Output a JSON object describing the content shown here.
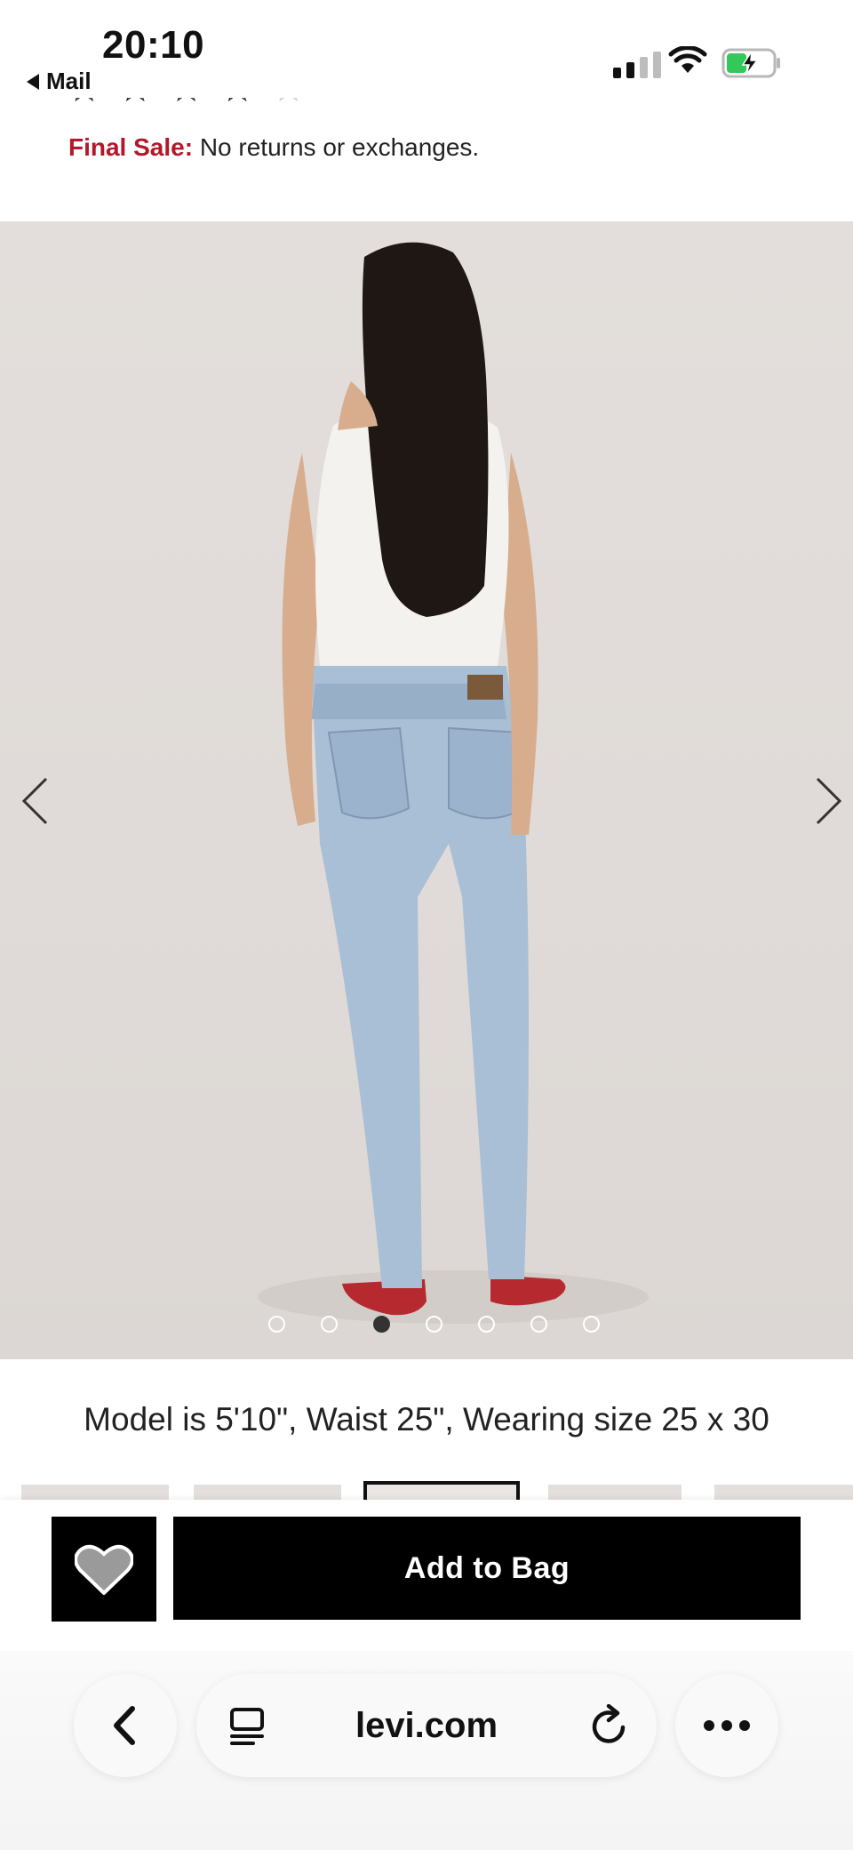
{
  "status_bar": {
    "time": "20:10",
    "back_label": "Mail",
    "icons": [
      "signal-icon",
      "wifi-icon",
      "battery-charging-icon"
    ]
  },
  "rating": {
    "stars_filled": 4,
    "stars_total": 5
  },
  "final_sale": {
    "label": "Final Sale:",
    "text": "No returns or exchanges.",
    "label_color": "#b3182a"
  },
  "gallery": {
    "image_description_icon": "product-photo-back-view",
    "dots_total": 7,
    "active_dot": 3,
    "prev_icon": "chevron-left-icon",
    "next_icon": "chevron-right-icon"
  },
  "model_info": "Model is 5'10\", Waist 25\", Wearing size 25 x 30",
  "actions": {
    "wishlist_icon": "heart-icon",
    "add_to_bag": "Add to Bag"
  },
  "browser": {
    "url": "levi.com",
    "icons": [
      "back-icon",
      "reader-icon",
      "reload-icon",
      "more-icon"
    ]
  },
  "colors": {
    "accent": "#b3182a",
    "button_bg": "#000000",
    "button_text": "#ffffff"
  }
}
